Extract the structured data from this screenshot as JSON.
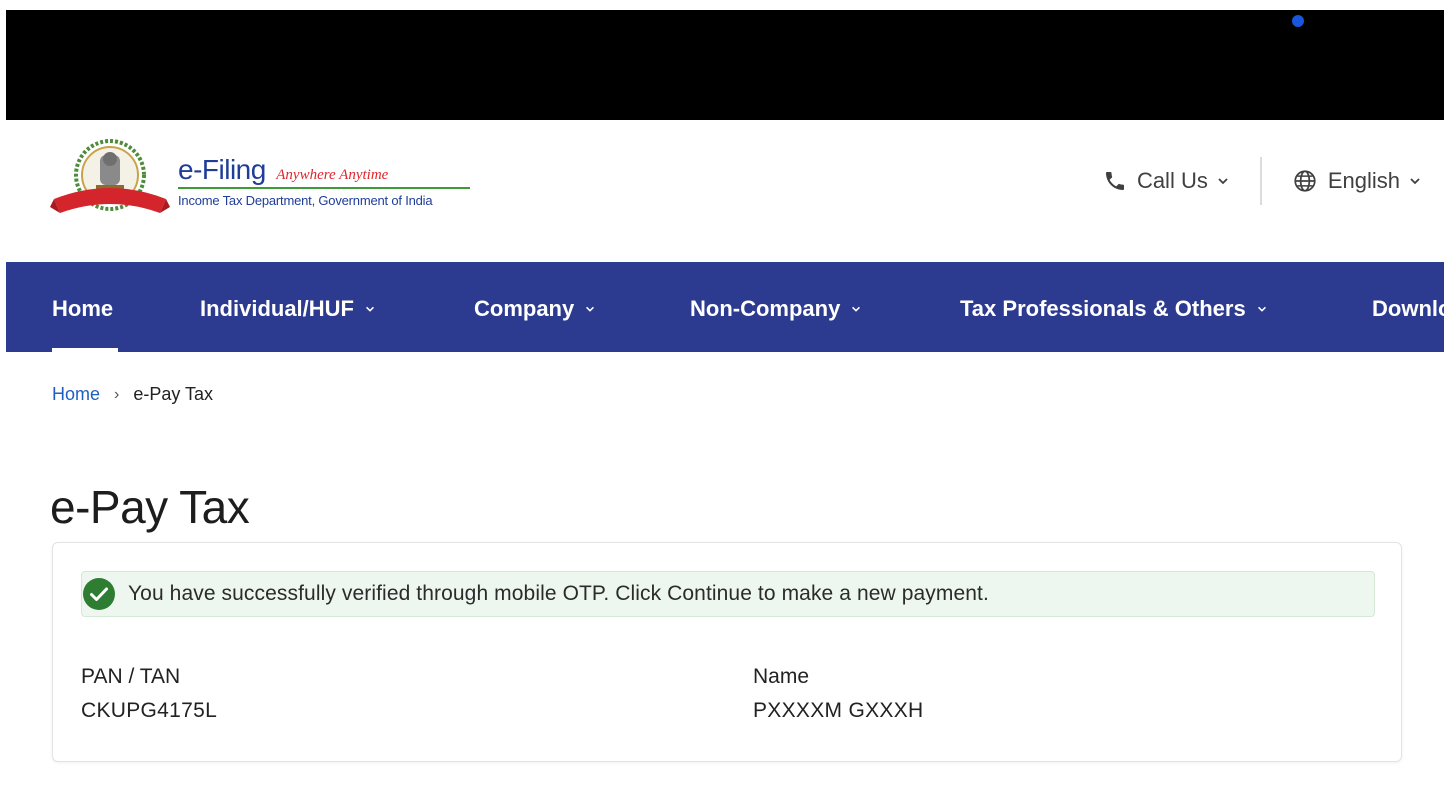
{
  "header": {
    "logo_main": "e-Filing",
    "logo_tagline": "Anywhere Anytime",
    "logo_subtitle": "Income Tax Department, Government of India",
    "call_us": "Call Us",
    "language": "English"
  },
  "nav": {
    "items": [
      {
        "label": "Home"
      },
      {
        "label": "Individual/HUF"
      },
      {
        "label": "Company"
      },
      {
        "label": "Non-Company"
      },
      {
        "label": "Tax Professionals & Others"
      },
      {
        "label": "Downlo"
      }
    ]
  },
  "breadcrumb": {
    "home": "Home",
    "separator": "›",
    "current": "e-Pay Tax"
  },
  "page": {
    "title": "e-Pay Tax"
  },
  "card": {
    "success_message": "You have successfully verified through mobile OTP. Click Continue to make a new payment.",
    "pan_label": "PAN / TAN",
    "pan_value": "CKUPG4175L",
    "name_label": "Name",
    "name_value": "PXXXXM GXXXH"
  },
  "colors": {
    "nav_bg": "#2c3b8f",
    "brand_blue": "#1f3d99",
    "tagline_red": "#e0262d",
    "success_green": "#2e7d32",
    "link_blue": "#1f5fbf"
  }
}
